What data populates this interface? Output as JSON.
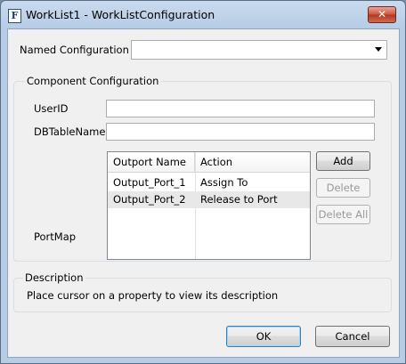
{
  "window": {
    "title": "WorkList1 - WorkListConfiguration",
    "app_icon_letter": "F",
    "close_glyph": "✕"
  },
  "named_configuration": {
    "label": "Named Configuration",
    "value": ""
  },
  "component_configuration": {
    "title": "Component Configuration",
    "userid": {
      "label": "UserID",
      "value": ""
    },
    "dbtablename": {
      "label": "DBTableName",
      "value": ""
    },
    "portmap": {
      "label": "PortMap",
      "columns": [
        "Outport Name",
        "Action"
      ],
      "rows": [
        {
          "outport": "Output_Port_1",
          "action": "Assign To",
          "selected": false
        },
        {
          "outport": "Output_Port_2",
          "action": "Release to Port",
          "selected": true
        }
      ],
      "buttons": {
        "add": {
          "label": "Add",
          "enabled": true
        },
        "delete": {
          "label": "Delete",
          "enabled": false
        },
        "delete_all": {
          "label": "Delete All",
          "enabled": false
        }
      }
    }
  },
  "description": {
    "title": "Description",
    "text": "Place cursor on a property to view its description"
  },
  "footer": {
    "ok_label": "OK",
    "cancel_label": "Cancel"
  },
  "colors": {
    "title_bar": "#c9daed",
    "close_button": "#c9533f",
    "selected_row": "#e8e8e8",
    "default_button_border": "#3c7fb1"
  }
}
